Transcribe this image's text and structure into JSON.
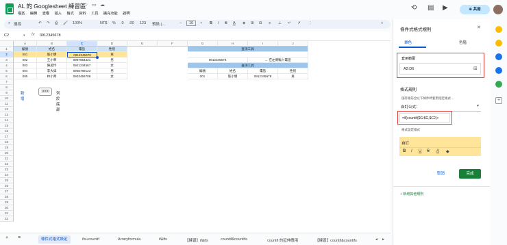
{
  "app": {
    "title": "AL 的 Googlesheet 練習區",
    "menu": [
      "檔案",
      "編輯",
      "查看",
      "插入",
      "格式",
      "資料",
      "工具",
      "擴充功能",
      "說明"
    ],
    "share_label": "共用",
    "colors": {
      "accent": "#0b57d0",
      "done_button": "#188038",
      "header_fill": "#cfe2f3",
      "highlight_fill": "#ffe599",
      "lookup_fill": "#9fc5e8",
      "error_border": "#e53935"
    }
  },
  "toolbar": {
    "search_label": "搜尋",
    "zoom": "100%",
    "currency": "NT$",
    "percent": "%",
    "decrease_decimal": ".0",
    "increase_decimal": ".00",
    "number_format": "123",
    "font": "預設 (...",
    "font_size": "10"
  },
  "formula_bar": {
    "cell_ref": "C2",
    "fx": "fx",
    "value": "0912345678"
  },
  "sheet": {
    "columns": [
      "A",
      "B",
      "C",
      "D",
      "E",
      "F",
      "G",
      "H",
      "I",
      "J"
    ],
    "rows": [
      "1",
      "2",
      "3",
      "4",
      "5",
      "6",
      "7",
      "8",
      "9",
      "10",
      "11",
      "12",
      "13",
      "14",
      "15",
      "16",
      "17",
      "18",
      "19",
      "20",
      "21",
      "22",
      "23",
      "24",
      "25",
      "26",
      "27",
      "28",
      "29",
      "30",
      "31",
      "32"
    ],
    "selected_col": "C",
    "selected_row": "2",
    "headers": [
      "編號",
      "姓名",
      "電話",
      "性別"
    ],
    "records": [
      [
        "001",
        "張小明",
        "0912345678",
        "男"
      ],
      [
        "002",
        "王小華",
        "0987654321",
        "男"
      ],
      [
        "003",
        "陳美玲",
        "0921234567",
        "女"
      ],
      [
        "004",
        "李大偉",
        "0955789123",
        "男"
      ],
      [
        "005",
        "林小青",
        "0933456789",
        "女"
      ]
    ],
    "lookup": {
      "title1": "查詢工具",
      "input": "0912345678",
      "hint": "← 在左側輸入電話",
      "title2": "查詢工具",
      "headers": [
        "編號",
        "姓名",
        "電話",
        "性別"
      ],
      "result": [
        "001",
        "張小明",
        "0912345678",
        "男"
      ]
    }
  },
  "add_rows": {
    "button": "新增",
    "count": "1000",
    "suffix": "列於底部"
  },
  "tabs": [
    "條件式格式設定",
    "ifs+countif",
    "Arraryformula",
    "if&ifs",
    "【練習】if&ifs",
    "countif&countifs",
    "countif 的延伸應用",
    "【練習】countif&countifs"
  ],
  "active_tab": 0,
  "panel": {
    "title": "條件式格式規則",
    "tab_single": "單色",
    "tab_scale": "色階",
    "range_label": "套用範圍",
    "range_value": "A2:D6",
    "rules_heading": "格式規則",
    "condition_label": "儲存格符合以下條件時套用指定格式…",
    "condition_value": "自訂公式：",
    "formula_value": "=if(countif($G:$G,$C2)>",
    "style_label": "格式設定樣式",
    "style_value": "自訂",
    "style_tools": [
      "B",
      "I",
      "U",
      "S",
      "A",
      "◆"
    ],
    "cancel": "取消",
    "done": "完成",
    "add_rule": "+ 新增其他規則"
  }
}
